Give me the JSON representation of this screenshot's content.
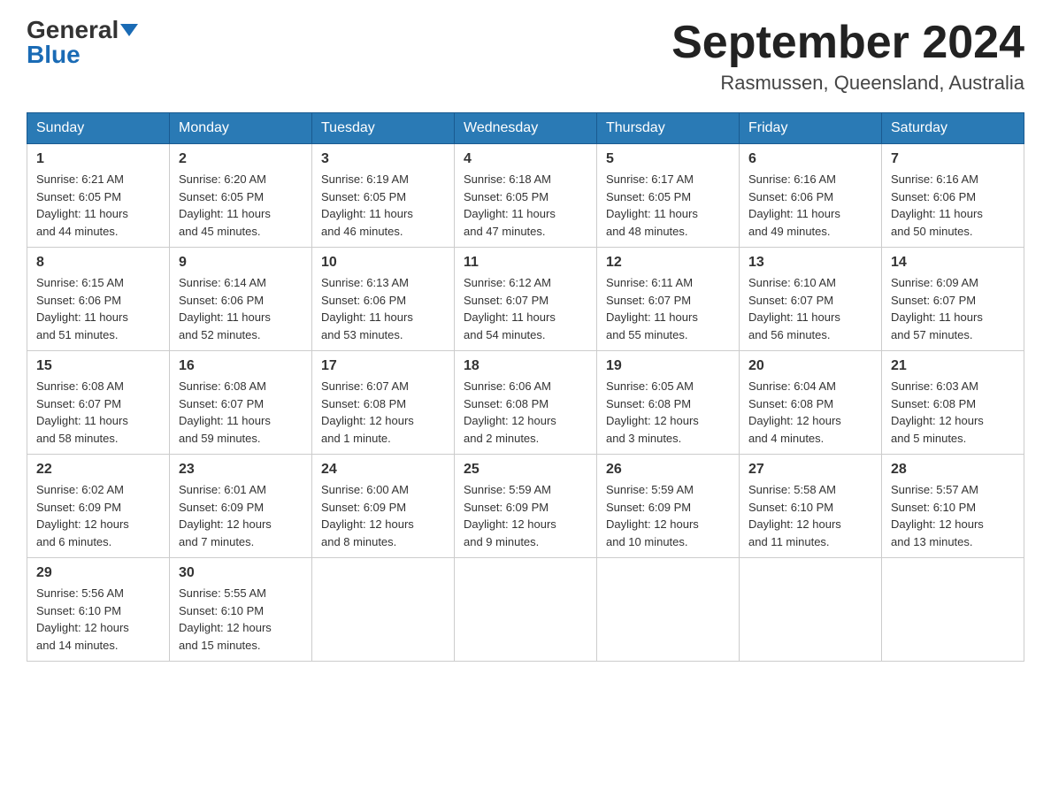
{
  "logo": {
    "general": "General",
    "blue": "Blue"
  },
  "title": "September 2024",
  "location": "Rasmussen, Queensland, Australia",
  "weekdays": [
    "Sunday",
    "Monday",
    "Tuesday",
    "Wednesday",
    "Thursday",
    "Friday",
    "Saturday"
  ],
  "weeks": [
    [
      {
        "day": "1",
        "sunrise": "6:21 AM",
        "sunset": "6:05 PM",
        "daylight": "11 hours and 44 minutes."
      },
      {
        "day": "2",
        "sunrise": "6:20 AM",
        "sunset": "6:05 PM",
        "daylight": "11 hours and 45 minutes."
      },
      {
        "day": "3",
        "sunrise": "6:19 AM",
        "sunset": "6:05 PM",
        "daylight": "11 hours and 46 minutes."
      },
      {
        "day": "4",
        "sunrise": "6:18 AM",
        "sunset": "6:05 PM",
        "daylight": "11 hours and 47 minutes."
      },
      {
        "day": "5",
        "sunrise": "6:17 AM",
        "sunset": "6:05 PM",
        "daylight": "11 hours and 48 minutes."
      },
      {
        "day": "6",
        "sunrise": "6:16 AM",
        "sunset": "6:06 PM",
        "daylight": "11 hours and 49 minutes."
      },
      {
        "day": "7",
        "sunrise": "6:16 AM",
        "sunset": "6:06 PM",
        "daylight": "11 hours and 50 minutes."
      }
    ],
    [
      {
        "day": "8",
        "sunrise": "6:15 AM",
        "sunset": "6:06 PM",
        "daylight": "11 hours and 51 minutes."
      },
      {
        "day": "9",
        "sunrise": "6:14 AM",
        "sunset": "6:06 PM",
        "daylight": "11 hours and 52 minutes."
      },
      {
        "day": "10",
        "sunrise": "6:13 AM",
        "sunset": "6:06 PM",
        "daylight": "11 hours and 53 minutes."
      },
      {
        "day": "11",
        "sunrise": "6:12 AM",
        "sunset": "6:07 PM",
        "daylight": "11 hours and 54 minutes."
      },
      {
        "day": "12",
        "sunrise": "6:11 AM",
        "sunset": "6:07 PM",
        "daylight": "11 hours and 55 minutes."
      },
      {
        "day": "13",
        "sunrise": "6:10 AM",
        "sunset": "6:07 PM",
        "daylight": "11 hours and 56 minutes."
      },
      {
        "day": "14",
        "sunrise": "6:09 AM",
        "sunset": "6:07 PM",
        "daylight": "11 hours and 57 minutes."
      }
    ],
    [
      {
        "day": "15",
        "sunrise": "6:08 AM",
        "sunset": "6:07 PM",
        "daylight": "11 hours and 58 minutes."
      },
      {
        "day": "16",
        "sunrise": "6:08 AM",
        "sunset": "6:07 PM",
        "daylight": "11 hours and 59 minutes."
      },
      {
        "day": "17",
        "sunrise": "6:07 AM",
        "sunset": "6:08 PM",
        "daylight": "12 hours and 1 minute."
      },
      {
        "day": "18",
        "sunrise": "6:06 AM",
        "sunset": "6:08 PM",
        "daylight": "12 hours and 2 minutes."
      },
      {
        "day": "19",
        "sunrise": "6:05 AM",
        "sunset": "6:08 PM",
        "daylight": "12 hours and 3 minutes."
      },
      {
        "day": "20",
        "sunrise": "6:04 AM",
        "sunset": "6:08 PM",
        "daylight": "12 hours and 4 minutes."
      },
      {
        "day": "21",
        "sunrise": "6:03 AM",
        "sunset": "6:08 PM",
        "daylight": "12 hours and 5 minutes."
      }
    ],
    [
      {
        "day": "22",
        "sunrise": "6:02 AM",
        "sunset": "6:09 PM",
        "daylight": "12 hours and 6 minutes."
      },
      {
        "day": "23",
        "sunrise": "6:01 AM",
        "sunset": "6:09 PM",
        "daylight": "12 hours and 7 minutes."
      },
      {
        "day": "24",
        "sunrise": "6:00 AM",
        "sunset": "6:09 PM",
        "daylight": "12 hours and 8 minutes."
      },
      {
        "day": "25",
        "sunrise": "5:59 AM",
        "sunset": "6:09 PM",
        "daylight": "12 hours and 9 minutes."
      },
      {
        "day": "26",
        "sunrise": "5:59 AM",
        "sunset": "6:09 PM",
        "daylight": "12 hours and 10 minutes."
      },
      {
        "day": "27",
        "sunrise": "5:58 AM",
        "sunset": "6:10 PM",
        "daylight": "12 hours and 11 minutes."
      },
      {
        "day": "28",
        "sunrise": "5:57 AM",
        "sunset": "6:10 PM",
        "daylight": "12 hours and 13 minutes."
      }
    ],
    [
      {
        "day": "29",
        "sunrise": "5:56 AM",
        "sunset": "6:10 PM",
        "daylight": "12 hours and 14 minutes."
      },
      {
        "day": "30",
        "sunrise": "5:55 AM",
        "sunset": "6:10 PM",
        "daylight": "12 hours and 15 minutes."
      },
      null,
      null,
      null,
      null,
      null
    ]
  ],
  "labels": {
    "sunrise": "Sunrise:",
    "sunset": "Sunset:",
    "daylight": "Daylight:"
  }
}
